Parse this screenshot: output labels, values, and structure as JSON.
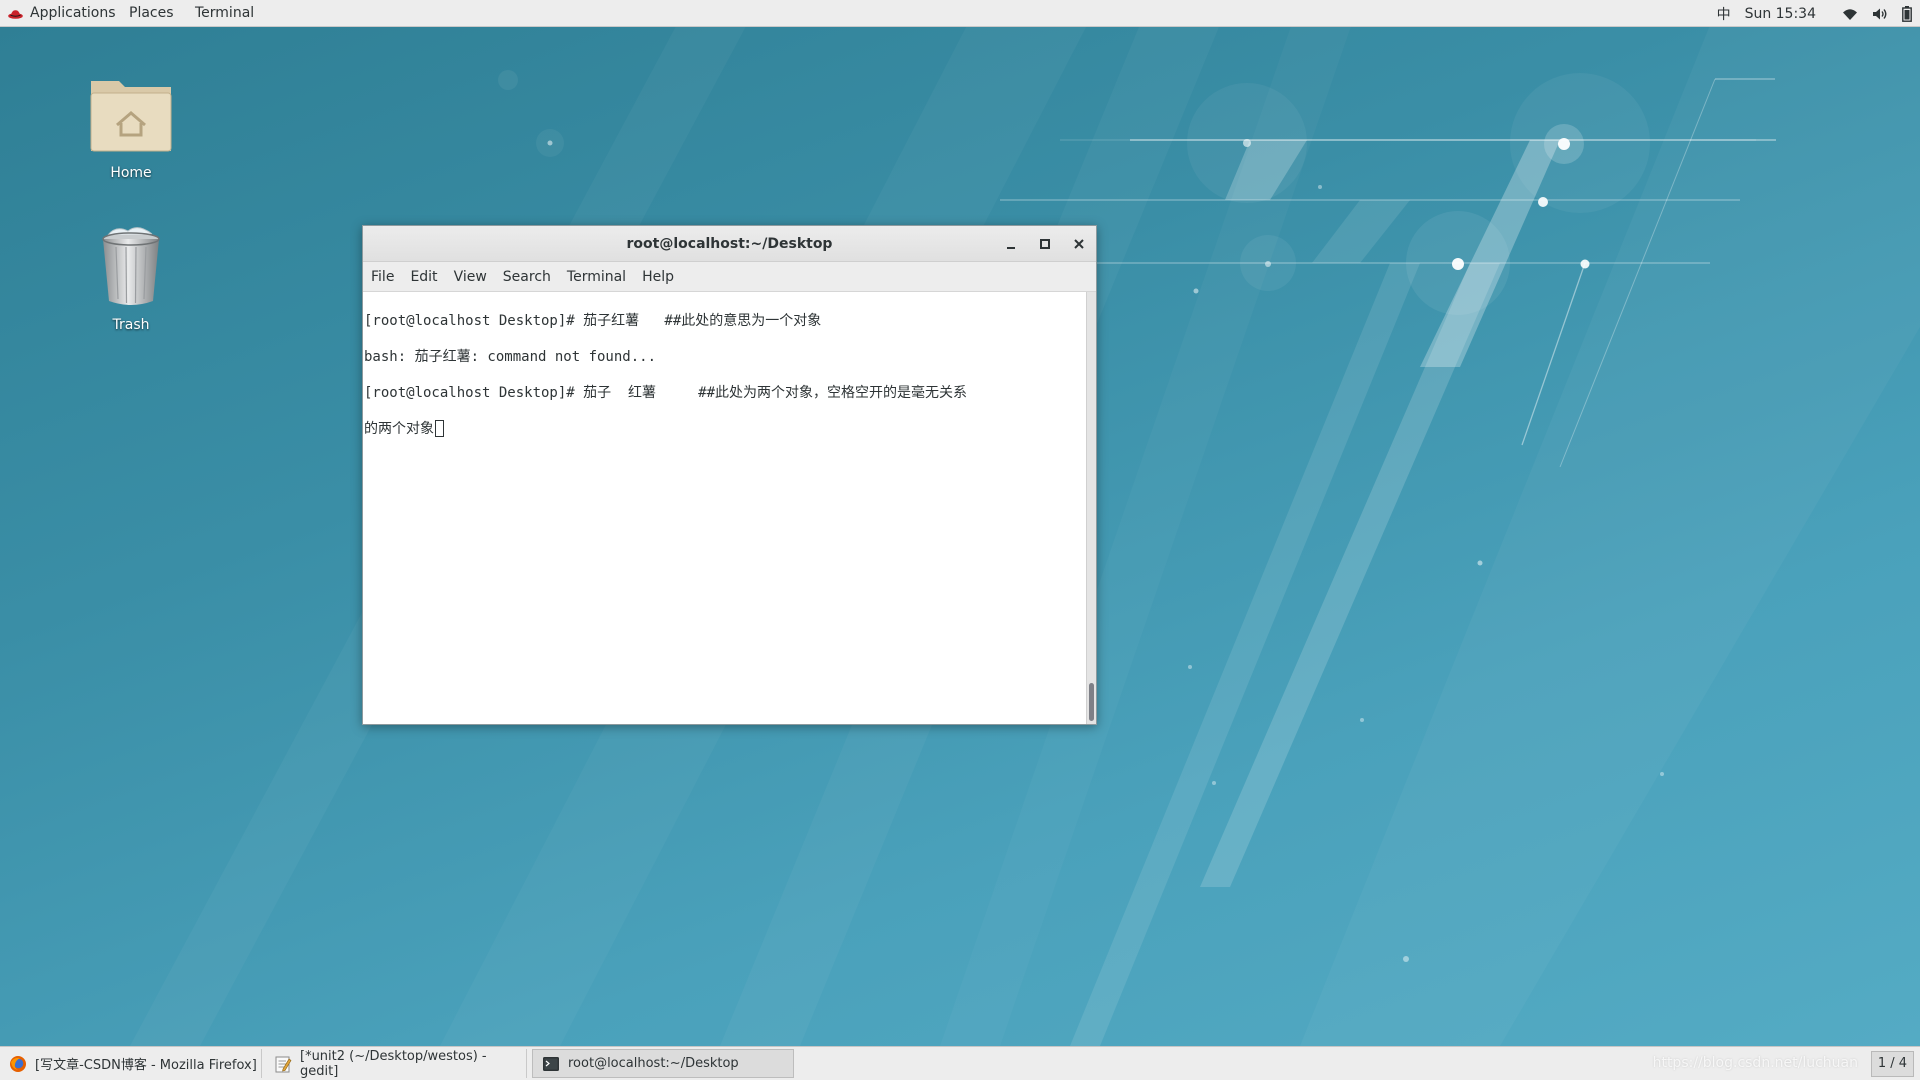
{
  "top_panel": {
    "applications": "Applications",
    "places": "Places",
    "terminal": "Terminal",
    "input_method": "中",
    "clock": "Sun 15:34",
    "icons": [
      "wifi-icon",
      "volume-icon",
      "battery-icon"
    ]
  },
  "desktop": {
    "icons": [
      {
        "label": "Home",
        "icon": "home-folder-icon"
      },
      {
        "label": "Trash",
        "icon": "trash-icon"
      }
    ]
  },
  "window": {
    "title": "root@localhost:~/Desktop",
    "menu": [
      "File",
      "Edit",
      "View",
      "Search",
      "Terminal",
      "Help"
    ],
    "terminal_lines": [
      "[root@localhost Desktop]# 茄子红薯   ##此处的意思为一个对象",
      "bash: 茄子红薯: command not found...",
      "[root@localhost Desktop]# 茄子  红薯     ##此处为两个对象，空格空开的是毫无关系",
      "的两个对象"
    ]
  },
  "taskbar": {
    "tasks": [
      {
        "label": "[写文章-CSDN博客 - Mozilla Firefox]",
        "icon": "firefox-icon"
      },
      {
        "label": "[*unit2 (~/Desktop/westos) - gedit]",
        "icon": "gedit-icon"
      },
      {
        "label": "root@localhost:~/Desktop",
        "icon": "terminal-icon"
      }
    ],
    "watermark": "https://blog.csdn.net/luchuan",
    "workspace": "1 / 4"
  },
  "colors": {
    "desktop_bg": "#3a8ea6",
    "panel_bg": "#ededed",
    "text": "#2e3436"
  }
}
